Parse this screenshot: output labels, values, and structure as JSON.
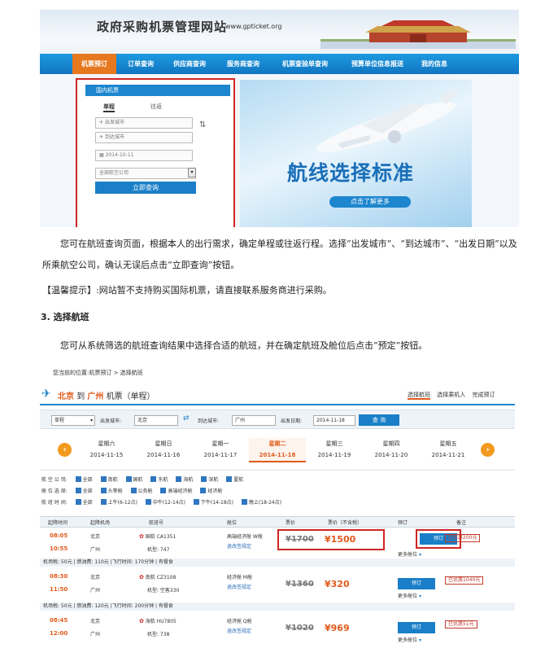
{
  "shot1": {
    "site_title": "政府采购机票管理网站",
    "site_url": "www.gpticket.org",
    "nav": [
      "机票预订",
      "订单查询",
      "供应商查询",
      "服务商查询",
      "机票查验单查询",
      "预算单位信息报送",
      "我的信息"
    ],
    "search": {
      "tab": "国内机票",
      "oneway": "单程",
      "roundtrip": "往返",
      "from_placeholder": "出发城市",
      "to_placeholder": "到达城市",
      "date": "2014-10-11",
      "airline": "全部航空公司",
      "submit": "立即查询"
    },
    "promo": {
      "headline": "航线选择标准",
      "link": "点击了解更多"
    }
  },
  "text": {
    "p1": "您可在航班查询页面，根据本人的出行需求，确定单程或往返行程。选择“出发城市”、“到达城市”、“出发日期”以及所乘航空公司，确认无误后点击“立即查询”按钮。",
    "p2": "【温馨提示】:网站暂不支持购买国际机票，请直接联系服务商进行采购。",
    "h3": "3. 选择航班",
    "p3": "您可从系统筛选的航班查询结果中选择合适的航班，并在确定航班及舱位后点击“预定”按钮。"
  },
  "shot2": {
    "breadcrumb": "您当前的位置:机票预订 > 选择航班",
    "route": {
      "from": "北京",
      "to_word": "到",
      "to": "广州",
      "suffix": "机票（单程）"
    },
    "steps": [
      "选择航班",
      "选择乘机人",
      "完成预订"
    ],
    "query": {
      "trip_type": "单程",
      "from_label": "出发城市:",
      "from_value": "北京",
      "to_label": "到达城市:",
      "to_value": "广州",
      "date_label": "出发日期:",
      "date_value": "2014-11-18",
      "button": "查 询"
    },
    "days": [
      {
        "weekday": "星期六",
        "date": "2014-11-15"
      },
      {
        "weekday": "星期日",
        "date": "2014-11-16"
      },
      {
        "weekday": "星期一",
        "date": "2014-11-17"
      },
      {
        "weekday": "星期二",
        "date": "2014-11-18"
      },
      {
        "weekday": "星期三",
        "date": "2014-11-19"
      },
      {
        "weekday": "星期四",
        "date": "2014-11-20"
      },
      {
        "weekday": "星期五",
        "date": "2014-11-21"
      }
    ],
    "filters": {
      "airline_label": "航 空 公 司:",
      "airlines": [
        "全部",
        "南航",
        "国航",
        "东航",
        "海航",
        "深航",
        "厦航"
      ],
      "cabin_label": "舱 位 选 择:",
      "cabins": [
        "全部",
        "头等舱",
        "公务舱",
        "高端经济舱",
        "经济舱"
      ],
      "time_label": "航 班 时 间:",
      "times": [
        "全部",
        "上午(6-12点)",
        "中午(12-14点)",
        "下午(14-18点)",
        "晚上(18-24点)"
      ]
    },
    "headers": [
      "起降时间",
      "起降机场",
      "航班号",
      "舱位",
      "票价",
      "票价（不含税）",
      "预订",
      "备注"
    ],
    "flights": [
      {
        "dep_time": "08:05",
        "arr_time": "10:55",
        "dep": "北京",
        "arr": "广州",
        "airline": "国航 CA1351",
        "model": "机型: 747",
        "cabin": "高端经济舱 W舱",
        "rule": "退改签规定",
        "old_price": "¥1700",
        "price": "¥1500",
        "book": "预订",
        "more": "更多舱位",
        "badge": "已优惠200元",
        "tax": "机场税: 50元 | 燃油费: 110元 |飞行时间: 170分钟 | 有餐食"
      },
      {
        "dep_time": "08:30",
        "arr_time": "11:50",
        "dep": "北京",
        "arr": "广州",
        "airline": "南航 CZ3108",
        "model": "机型: 空客330",
        "cabin": "经济舱 M舱",
        "rule": "退改签规定",
        "old_price": "¥1360",
        "price": "¥320",
        "book": "预订",
        "more": "更多舱位",
        "badge": "已优惠1040元",
        "tax": "机场税: 50元 | 燃油费: 120元 |飞行时间: 200分钟 | 有餐食"
      },
      {
        "dep_time": "08:45",
        "arr_time": "12:00",
        "dep": "北京",
        "arr": "广州",
        "airline": "海航 HU7805",
        "model": "机型: 738",
        "cabin": "经济舱 Q舱",
        "rule": "退改签规定",
        "old_price": "¥1020",
        "price": "¥969",
        "book": "预订",
        "more": "更多舱位",
        "badge": "已优惠51元"
      }
    ]
  }
}
